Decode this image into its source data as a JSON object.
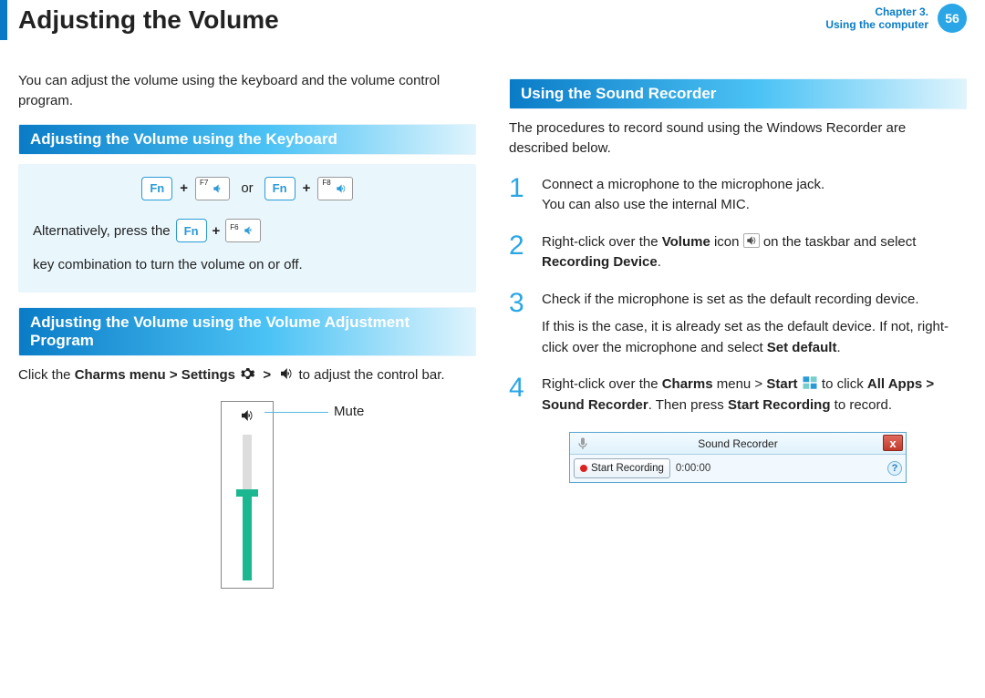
{
  "header": {
    "title": "Adjusting the Volume",
    "chapter_line1": "Chapter 3.",
    "chapter_line2": "Using the computer",
    "page_number": "56"
  },
  "left": {
    "intro": "You can adjust the volume using the keyboard and the volume control program.",
    "sec1_title": "Adjusting the Volume using the Keyboard",
    "keys": {
      "fn": "Fn",
      "plus": "+",
      "f7": "F7",
      "or": "or",
      "f8": "F8",
      "f6": "F6"
    },
    "alt_pre": "Alternatively, press the",
    "alt_post": "key combination to turn the volume on or off.",
    "sec2_title": "Adjusting the Volume using the Volume Adjustment Program",
    "click_pre": "Click the ",
    "charms_path": "Charms menu > Settings",
    "click_post": " to adjust the control bar.",
    "mute": "Mute"
  },
  "right": {
    "sec_title": "Using the Sound Recorder",
    "intro": "The procedures to record sound using the Windows Recorder are described below.",
    "steps": {
      "s1a": "Connect a microphone to the microphone jack.",
      "s1b": "You can also use the internal MIC.",
      "s2_pre": "Right-click over the ",
      "s2_vol": "Volume",
      "s2_mid": " icon ",
      "s2_post": " on the taskbar and select ",
      "s2_rec": "Recording Device",
      "s2_end": ".",
      "s3a": "Check if the microphone is set as the default recording device.",
      "s3b_pre": "If this is the case, it is already set as the default device. If not, right-click over the microphone and select ",
      "s3b_bold": "Set default",
      "s3b_end": ".",
      "s4_pre": "Right-click over the ",
      "s4_charms": "Charms",
      "s4_mid1": " menu > ",
      "s4_start": "Start",
      "s4_mid2": " to click ",
      "s4_all": "All Apps > Sound Recorder",
      "s4_mid3": ". Then press ",
      "s4_sr": "Start Recording",
      "s4_end": " to record."
    },
    "recorder": {
      "title": "Sound Recorder",
      "button": "Start Recording",
      "time": "0:00:00",
      "close": "x",
      "help": "?"
    },
    "numbers": {
      "n1": "1",
      "n2": "2",
      "n3": "3",
      "n4": "4"
    }
  }
}
